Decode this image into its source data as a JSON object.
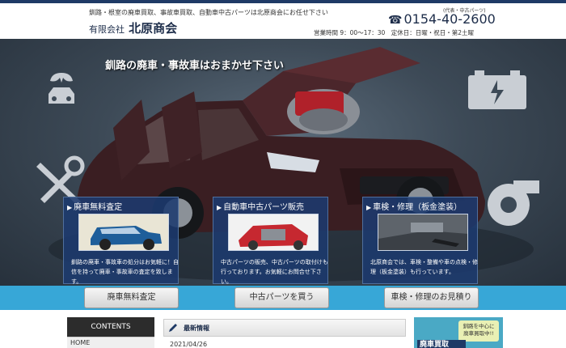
{
  "header": {
    "tagline": "釧路・根室の廃車買取、事故車買取、自動車中古パーツは北原商会にお任せ下さい",
    "company_kind": "有限会社",
    "company_name": "北原商会",
    "phone_note": "(代表・中古パーツ)",
    "phone_icon": "☎",
    "phone": "0154-40-2600",
    "hours": "営業時間 9：00〜17：30　定休日：日曜・祝日・第2土曜"
  },
  "hero": {
    "title": "釧路の廃車・事故車はおまかせ下さい"
  },
  "panels": [
    {
      "title": "廃車無料査定",
      "text": "釧路の廃車・事故車の処分はお気軽に！自信を持って廃車・事故車の査定を致します。"
    },
    {
      "title": "自動車中古パーツ販売",
      "text": "中古パーツの販売、中古パーツの取付けも行っております。お気軽にお問合せ下さい。"
    },
    {
      "title": "車検・修理（板金塗装）",
      "text": "北原商会では、車検・整備や車の点検・修理（板金塗装）も行っています。"
    }
  ],
  "buttons": [
    "廃車無料査定",
    "中古パーツを買う",
    "車検・修理のお見積り"
  ],
  "sidebar": {
    "title": "CONTENTS",
    "items": [
      "HOME"
    ]
  },
  "news": {
    "title": "最新情報",
    "date": "2021/04/26"
  },
  "banner": {
    "bubble": "釧路を中心に\n廃車買取中!!",
    "plate": "廃車買取"
  },
  "colors": {
    "navy": "#1f3a66",
    "band": "#37a7d7",
    "panel": "#1c3a6e"
  }
}
